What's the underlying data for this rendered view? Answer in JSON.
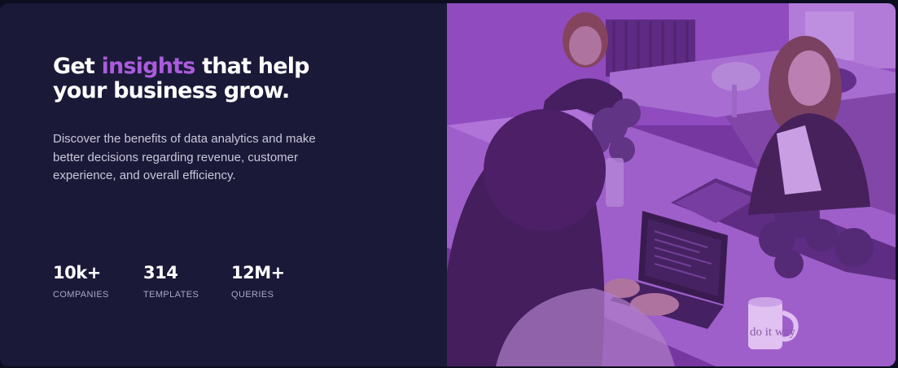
{
  "hero": {
    "headline_part1": "Get ",
    "headline_accent": "insights",
    "headline_part2": " that help your business grow.",
    "description": "Discover the benefits of data analytics and make better decisions regarding revenue, customer experience, and overall efficiency."
  },
  "stats": [
    {
      "value": "10k+",
      "label": "COMPANIES"
    },
    {
      "value": "314",
      "label": "TEMPLATES"
    },
    {
      "value": "12M+",
      "label": "QUERIES"
    }
  ],
  "image": {
    "mug_text": "do it way"
  },
  "colors": {
    "background": "#1b1938",
    "accent": "#aa5cdb",
    "body_text": "#c8c7d9",
    "label_text": "#a9a7c2",
    "photo_tint": "#aa5cdb"
  }
}
